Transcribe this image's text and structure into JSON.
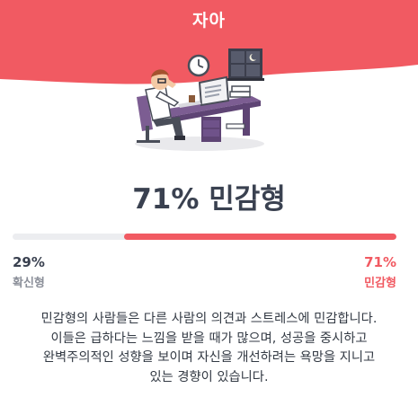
{
  "header": {
    "title": "자아",
    "background": "#f15a62"
  },
  "result": {
    "percent": "71%",
    "type": "민감형",
    "fraction": 0.71
  },
  "scale": {
    "left_percent": "29%",
    "left_label": "확신형",
    "right_percent": "71%",
    "right_label": "민감형",
    "fill_color": "#f15a62",
    "track_color": "#ecedf0"
  },
  "description": {
    "lines": [
      "민감형의 사람들은 다른 사람의 의견과 스트레스에 민감합니다.",
      "이들은 급하다는 느낌을 받을 때가 많으며, 성공을 중시하고",
      "완벽주의적인 성향을 보이며 자신을 개선하려는 욕망을 지니고",
      "있는 경향이 있습니다."
    ]
  },
  "illustration": {
    "icons": [
      "wall-clock-icon",
      "night-window-icon",
      "person-at-desk-illustration"
    ]
  }
}
